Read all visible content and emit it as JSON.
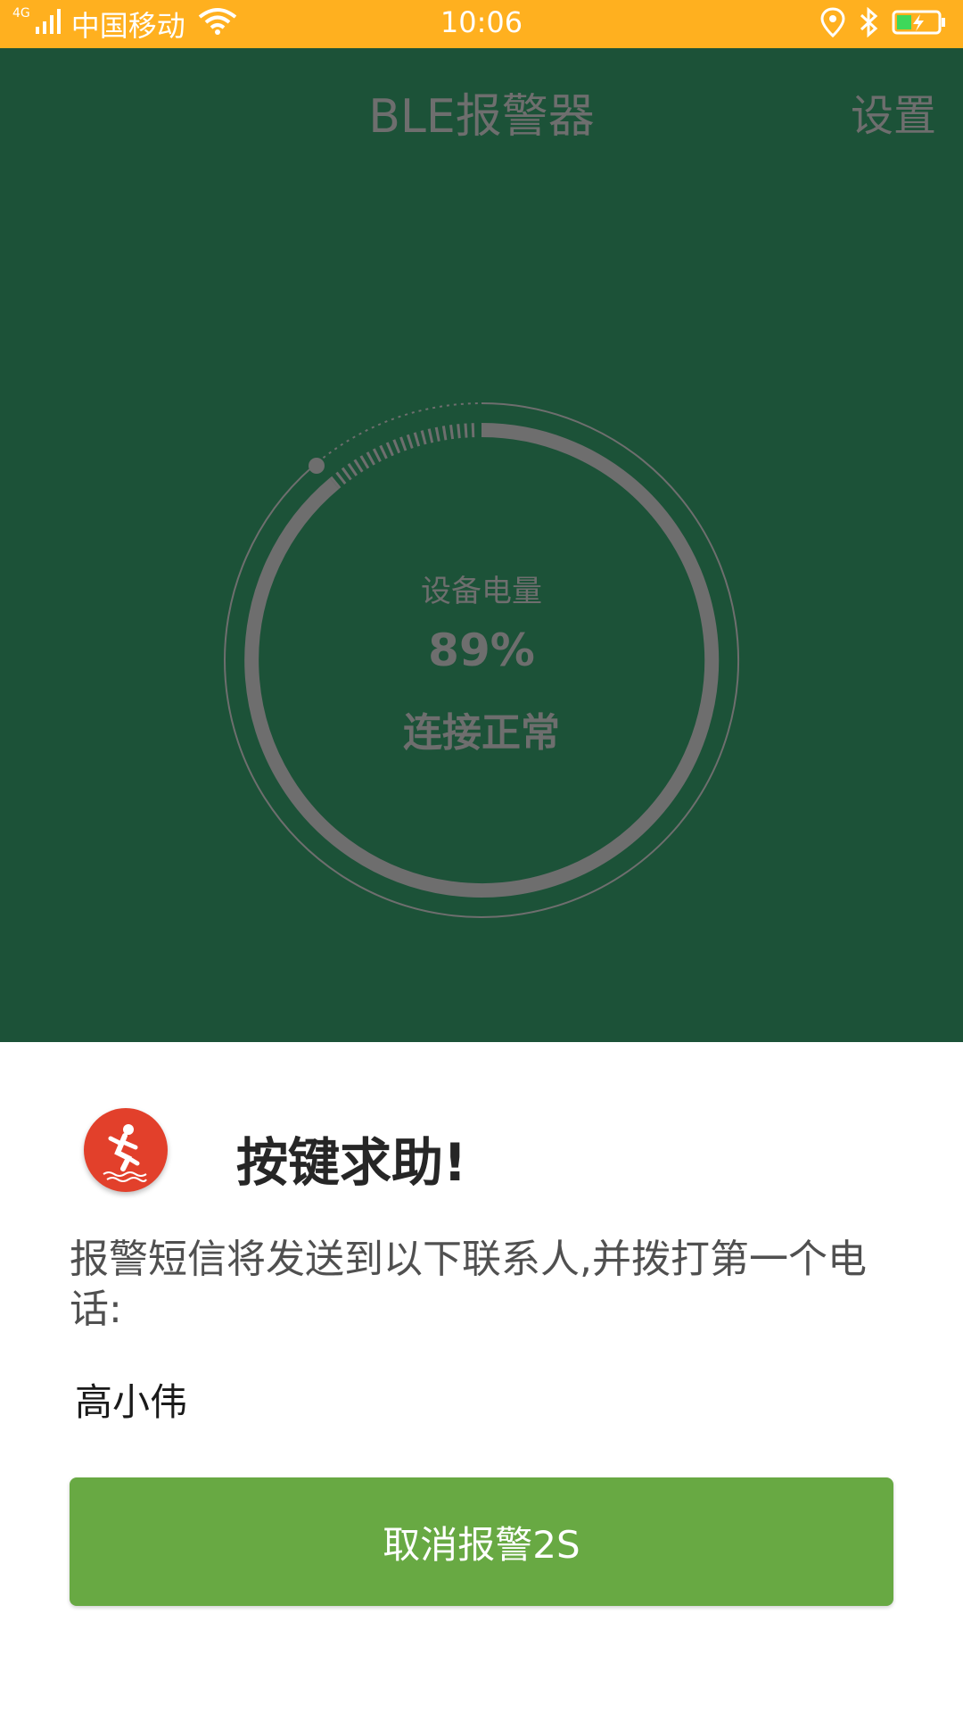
{
  "status_bar": {
    "network_type": "4G",
    "carrier": "中国移动",
    "time": "10:06",
    "icons": [
      "signal-icon",
      "wifi-icon",
      "location-icon",
      "bluetooth-icon",
      "battery-icon"
    ]
  },
  "header": {
    "title": "BLE报警器",
    "settings_label": "设置"
  },
  "gauge": {
    "title": "设备电量",
    "value": "89%",
    "level": 0.89,
    "status": "连接正常"
  },
  "dialog": {
    "icon": "fall-alert-icon",
    "title": "按键求助!",
    "message": "报警短信将发送到以下联系人,并拨打第一个电话:",
    "contacts": [
      "高小伟"
    ],
    "cancel_button_label": "取消报警2S"
  },
  "colors": {
    "status_bar": "#ffb01f",
    "background": "#1c5238",
    "accent_button": "#68a943",
    "alert_red": "#e2402b",
    "gauge_gray": "#6e6e6e"
  }
}
